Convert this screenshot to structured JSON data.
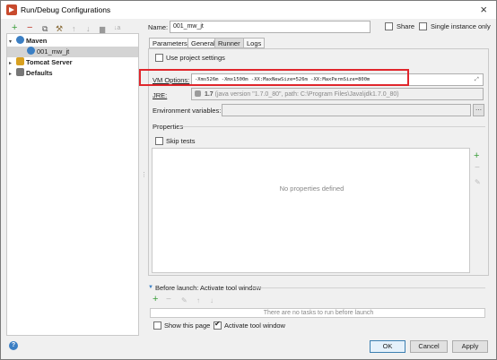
{
  "window": {
    "title": "Run/Debug Configurations",
    "close_glyph": "×"
  },
  "left_toolbar": {
    "add": "+",
    "remove": "−",
    "copy": "⧉",
    "settings": "⚒",
    "up": "↑",
    "down": "↓",
    "folder": "▆",
    "sort": "↓a"
  },
  "tree": {
    "items": [
      {
        "label": "Maven",
        "arrow": "▾",
        "level": 0,
        "icon_color": "#3b7fc4"
      },
      {
        "label": "001_mw_jt",
        "arrow": "",
        "level": 1,
        "icon_color": "#3b7fc4",
        "selected": true
      },
      {
        "label": "Tomcat Server",
        "arrow": "▸",
        "level": 0,
        "icon_color": "#d8a020"
      },
      {
        "label": "Defaults",
        "arrow": "▸",
        "level": 0,
        "icon_color": "#777777"
      }
    ]
  },
  "name_row": {
    "label": "Name:",
    "value": "001_mw_jt",
    "share_label": "Share",
    "single_instance_label": "Single instance only"
  },
  "tabs": [
    "Parameters",
    "General",
    "Runner",
    "Logs"
  ],
  "runner": {
    "use_project_settings": "Use project settings",
    "vm_options_label": "VM Options:",
    "vm_options_value": "-Xms526m -Xmx1500m -XX:MaxNewSize=526m -XX:MaxPermSize=800m",
    "jre_label": "JRE:",
    "jre_value_prefix": "1.7",
    "jre_value_detail": "(java version \"1.7.0_80\", path: C:\\Program Files\\Java\\jdk1.7.0_80)",
    "env_label": "Environment variables:",
    "properties_label": "Properties",
    "skip_tests": "Skip tests",
    "no_properties": "No properties defined",
    "props_add": "+",
    "props_remove": "−",
    "props_edit": "✎"
  },
  "before_launch": {
    "label": "Before launch: Activate tool window",
    "empty_text": "There are no tasks to run before launch",
    "add": "+",
    "remove": "−",
    "edit": "✎",
    "up": "↑",
    "down": "↓"
  },
  "bottom": {
    "show_page": "Show this page",
    "activate_tool_window": "Activate tool window",
    "ok": "OK",
    "cancel": "Cancel",
    "apply": "Apply",
    "help": "?"
  }
}
